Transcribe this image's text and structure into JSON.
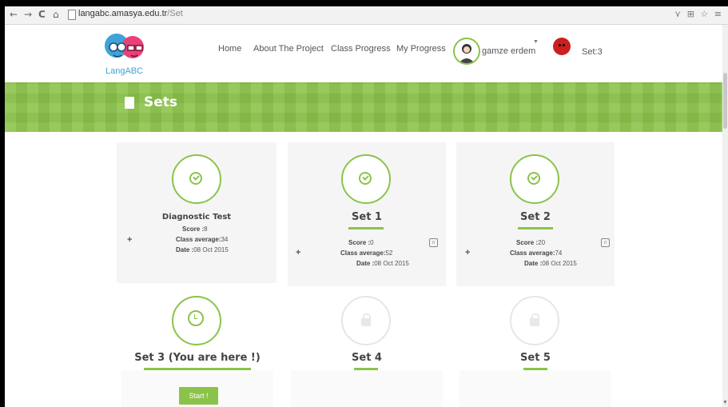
{
  "browser": {
    "back": "←",
    "forward": "→",
    "reload": "C",
    "home": "⌂",
    "url_host": "langabc.amasya.edu.tr",
    "url_path": "/Set",
    "icons_right": "⋎ ⊞ ☆ ≡"
  },
  "header": {
    "logo_text": "LangABC",
    "nav": [
      "Home",
      "About The Project",
      "Class Progress",
      "My Progress"
    ],
    "username": "gamze erdem",
    "set_indicator": "Set:3"
  },
  "banner": {
    "title": "Sets"
  },
  "sets": [
    {
      "title": "Diagnostic Test",
      "status": "completed",
      "score_label": "Score :",
      "score": "8",
      "avg_label": "Class average:",
      "avg": "34",
      "date_label": "Date :",
      "date": "08 Oct 2015"
    },
    {
      "title": "Set 1",
      "status": "completed",
      "score_label": "Score :",
      "score": "0",
      "avg_label": "Class average:",
      "avg": "52",
      "date_label": "Date :",
      "date": "08 Oct 2015"
    },
    {
      "title": "Set 2",
      "status": "completed",
      "score_label": "Score :",
      "score": "20",
      "avg_label": "Class average:",
      "avg": "74",
      "date_label": "Date :",
      "date": "08 Oct 2015"
    },
    {
      "title": "Set 3 (You are here !)",
      "status": "current"
    },
    {
      "title": "Set 4",
      "status": "locked"
    },
    {
      "title": "Set 5",
      "status": "locked"
    }
  ],
  "start_button": "Start !",
  "colors": {
    "accent": "#8bc34a",
    "set_dot": "#cc1f1f"
  }
}
